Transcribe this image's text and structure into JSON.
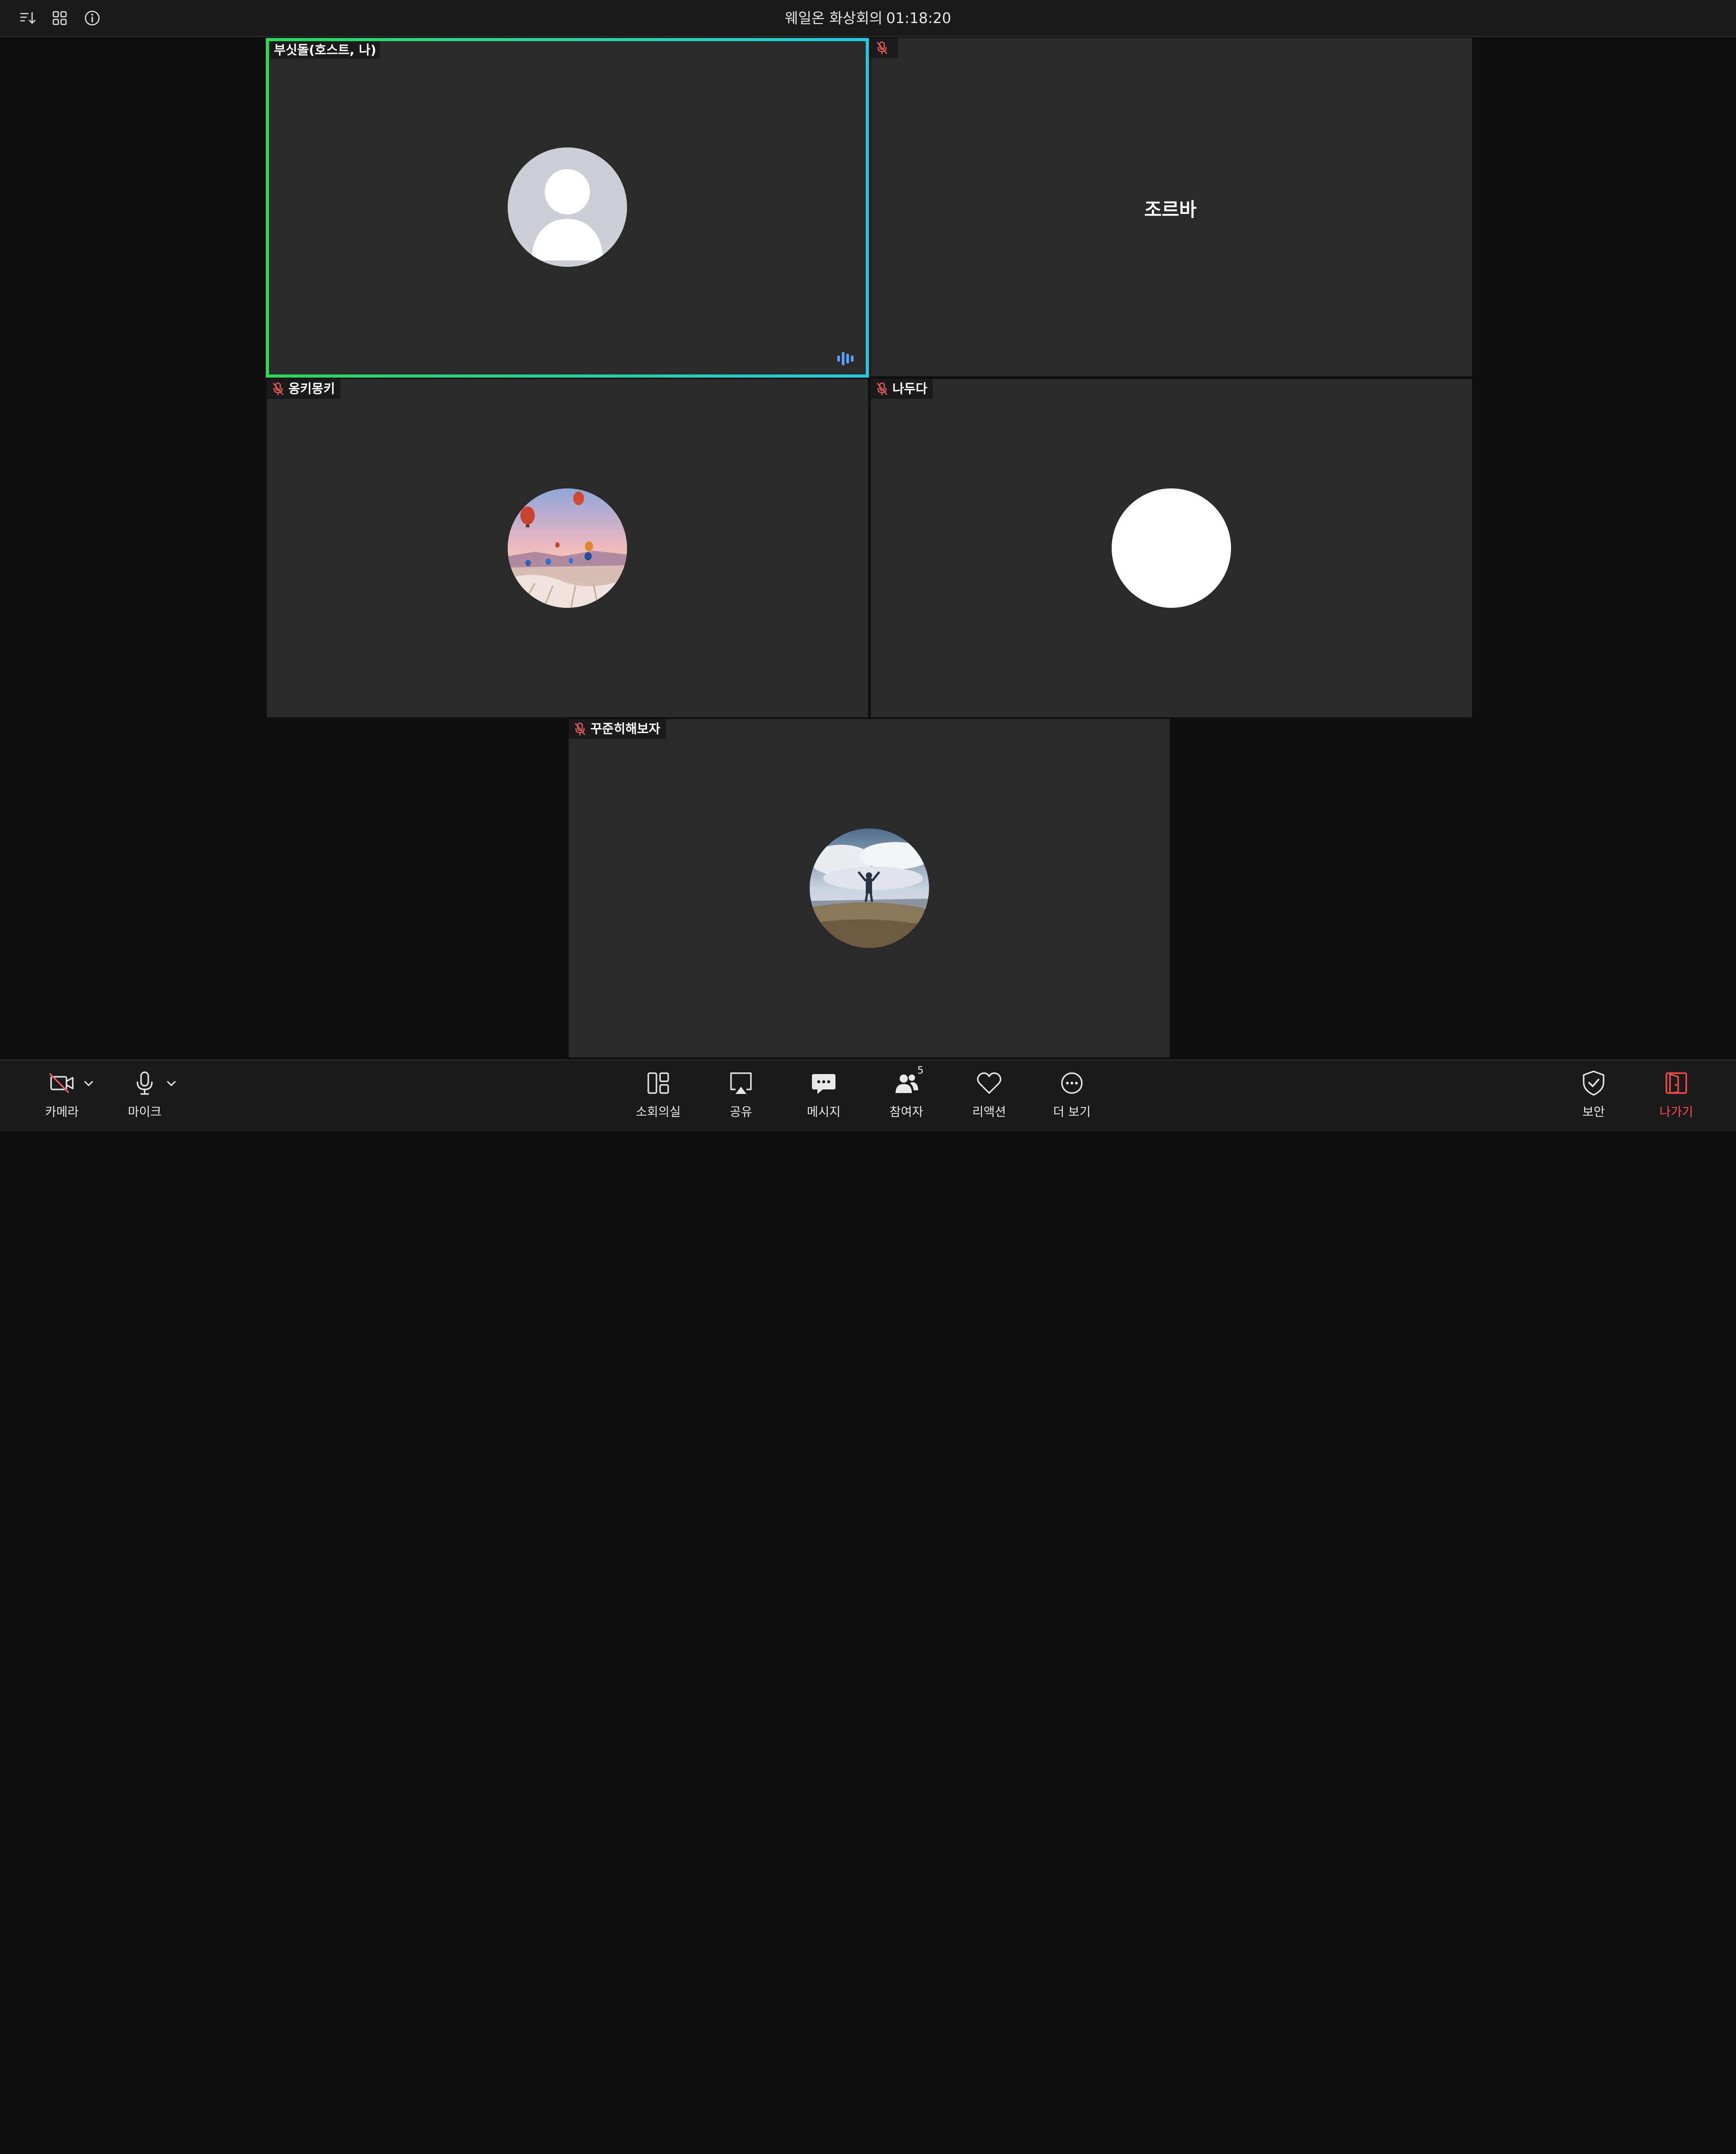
{
  "topbar": {
    "title": "웨일온 화상회의",
    "timer": "01:18:20",
    "icons": [
      "sort-icon",
      "grid-view-icon",
      "info-icon"
    ]
  },
  "participants": [
    {
      "name": "부싯돌(호스트, 나)",
      "muted": false,
      "speaking": true,
      "avatar": "default-person"
    },
    {
      "name": "",
      "display_name": "조르바",
      "muted": true,
      "avatar": "none"
    },
    {
      "name": "옹키몽키",
      "muted": true,
      "avatar": "balloon-photo"
    },
    {
      "name": "나두다",
      "muted": true,
      "avatar": "white-circle"
    },
    {
      "name": "꾸준히해보자",
      "muted": true,
      "avatar": "mountain-photo"
    }
  ],
  "toolbar": {
    "camera": {
      "label": "카메라",
      "icon": "camera-off-icon"
    },
    "mic": {
      "label": "마이크",
      "icon": "microphone-icon"
    },
    "breakout": {
      "label": "소회의실",
      "icon": "breakout-rooms-icon"
    },
    "share": {
      "label": "공유",
      "icon": "screen-share-icon"
    },
    "message": {
      "label": "메시지",
      "icon": "chat-icon"
    },
    "participants": {
      "label": "참여자",
      "icon": "participants-icon",
      "count": "5"
    },
    "reaction": {
      "label": "리액션",
      "icon": "heart-icon"
    },
    "more": {
      "label": "더 보기",
      "icon": "more-icon"
    },
    "security": {
      "label": "보안",
      "icon": "shield-icon"
    },
    "leave": {
      "label": "나가기",
      "icon": "exit-icon"
    }
  },
  "colors": {
    "active_speaker_border_start": "#2fd85a",
    "active_speaker_border_end": "#21c9e0",
    "muted_mic": "#e05a5a",
    "leave": "#ff4d4d",
    "tile_bg": "#2a2a2a"
  }
}
